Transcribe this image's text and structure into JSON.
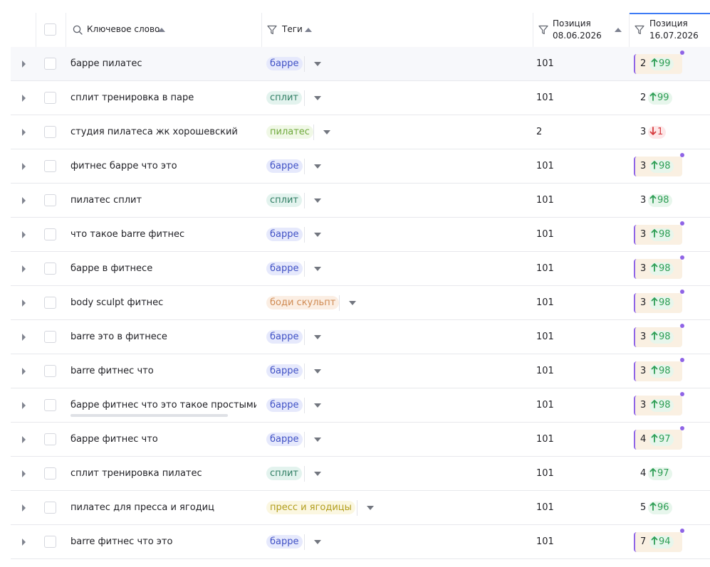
{
  "header": {
    "keyword": "Ключевое слово",
    "tags": "Теги",
    "pos1_label": "Позиция",
    "pos1_date": "08.06.2026",
    "pos2_label": "Позиция",
    "pos2_date": "16.07.2026"
  },
  "colors": {
    "accent": "#3d7bf5",
    "highlight_bg": "#faf0e2",
    "marker": "#8f64e6",
    "up": "#2e9e55",
    "down": "#d53a3e"
  },
  "tag_styles": {
    "барре": {
      "bg": "#e6e9fc",
      "fg": "#3f50c5"
    },
    "сплит": {
      "bg": "#e3f3ee",
      "fg": "#2f7d63"
    },
    "пилатес": {
      "bg": "#f0f8e6",
      "fg": "#6fa93c"
    },
    "боди скульпт": {
      "bg": "#fbeee3",
      "fg": "#cf8a52"
    },
    "пресс и ягодицы": {
      "bg": "#fbf7e1",
      "fg": "#b29d1c"
    }
  },
  "rows": [
    {
      "keyword": "барре пилатес",
      "tag": "барре",
      "pos1": "101",
      "pos2": "2",
      "delta": "99",
      "dir": "up",
      "marked": true
    },
    {
      "keyword": "сплит тренировка в паре",
      "tag": "сплит",
      "pos1": "101",
      "pos2": "2",
      "delta": "99",
      "dir": "up",
      "marked": false
    },
    {
      "keyword": "студия пилатеса жк хорошевский",
      "tag": "пилатес",
      "pos1": "2",
      "pos2": "3",
      "delta": "1",
      "dir": "down",
      "marked": false
    },
    {
      "keyword": "фитнес барре что это",
      "tag": "барре",
      "pos1": "101",
      "pos2": "3",
      "delta": "98",
      "dir": "up",
      "marked": true
    },
    {
      "keyword": "пилатес сплит",
      "tag": "сплит",
      "pos1": "101",
      "pos2": "3",
      "delta": "98",
      "dir": "up",
      "marked": false
    },
    {
      "keyword": "что такое barre фитнес",
      "tag": "барре",
      "pos1": "101",
      "pos2": "3",
      "delta": "98",
      "dir": "up",
      "marked": true
    },
    {
      "keyword": "барре в фитнесе",
      "tag": "барре",
      "pos1": "101",
      "pos2": "3",
      "delta": "98",
      "dir": "up",
      "marked": true
    },
    {
      "keyword": "body sculpt фитнес",
      "tag": "боди скульпт",
      "pos1": "101",
      "pos2": "3",
      "delta": "98",
      "dir": "up",
      "marked": true
    },
    {
      "keyword": "barre это в фитнесе",
      "tag": "барре",
      "pos1": "101",
      "pos2": "3",
      "delta": "98",
      "dir": "up",
      "marked": true
    },
    {
      "keyword": "barre фитнес что",
      "tag": "барре",
      "pos1": "101",
      "pos2": "3",
      "delta": "98",
      "dir": "up",
      "marked": true
    },
    {
      "keyword": "барре фитнес что это такое простыми сл",
      "tag": "барре",
      "pos1": "101",
      "pos2": "3",
      "delta": "98",
      "dir": "up",
      "marked": true,
      "scroll": true
    },
    {
      "keyword": "барре фитнес что",
      "tag": "барре",
      "pos1": "101",
      "pos2": "4",
      "delta": "97",
      "dir": "up",
      "marked": true
    },
    {
      "keyword": "сплит тренировка пилатес",
      "tag": "сплит",
      "pos1": "101",
      "pos2": "4",
      "delta": "97",
      "dir": "up",
      "marked": false
    },
    {
      "keyword": "пилатес для пресса и ягодиц",
      "tag": "пресс и ягодицы",
      "pos1": "101",
      "pos2": "5",
      "delta": "96",
      "dir": "up",
      "marked": false
    },
    {
      "keyword": "barre фитнес что это",
      "tag": "барре",
      "pos1": "101",
      "pos2": "7",
      "delta": "94",
      "dir": "up",
      "marked": true
    }
  ]
}
